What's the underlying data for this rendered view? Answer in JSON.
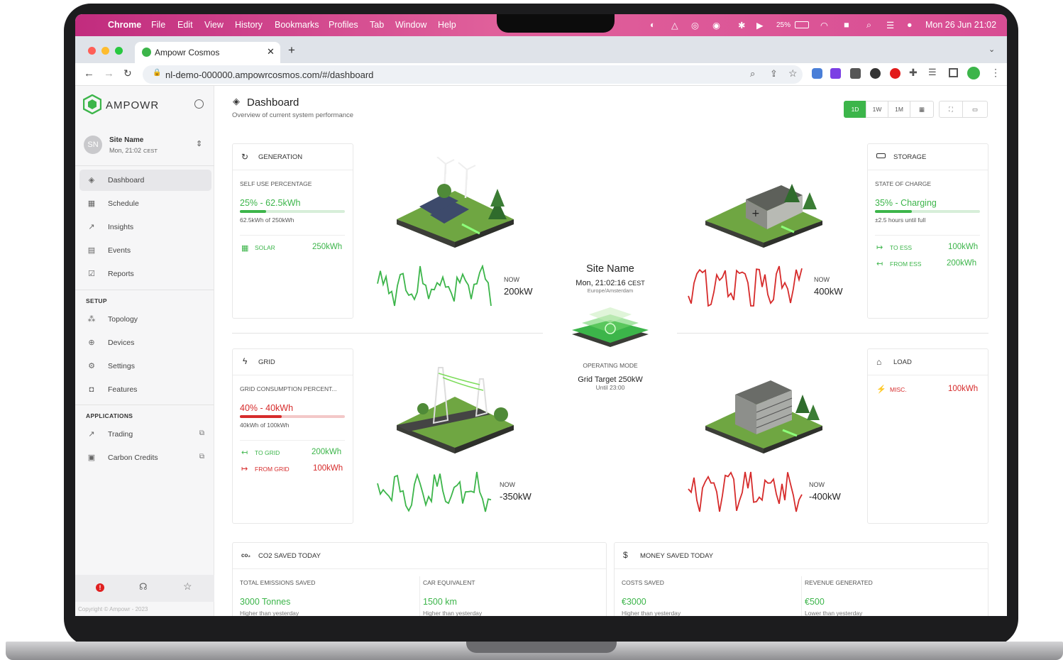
{
  "macos": {
    "app_name": "Chrome",
    "menus": [
      "File",
      "Edit",
      "View",
      "History",
      "Bookmarks",
      "Profiles",
      "Tab",
      "Window",
      "Help"
    ],
    "battery": "25%",
    "datetime": "Mon 26 Jun  21:02"
  },
  "browser": {
    "tab_title": "Ampowr Cosmos",
    "url": "nl-demo-000000.ampowrcosmos.com/#/dashboard"
  },
  "sidebar": {
    "logo_text": "AMPOWR",
    "site": {
      "initials": "SN",
      "name": "Site Name",
      "time": "Mon, 21:02",
      "tz": "CEST"
    },
    "main_items": [
      {
        "label": "Dashboard",
        "icon": "layers-icon"
      },
      {
        "label": "Schedule",
        "icon": "calendar-icon"
      },
      {
        "label": "Insights",
        "icon": "trend-icon"
      },
      {
        "label": "Events",
        "icon": "list-icon"
      },
      {
        "label": "Reports",
        "icon": "checkbox-icon"
      }
    ],
    "setup_title": "SETUP",
    "setup_items": [
      {
        "label": "Topology",
        "icon": "topology-icon"
      },
      {
        "label": "Devices",
        "icon": "device-icon"
      },
      {
        "label": "Settings",
        "icon": "gear-icon"
      },
      {
        "label": "Features",
        "icon": "bag-icon"
      }
    ],
    "apps_title": "APPLICATIONS",
    "app_items": [
      {
        "label": "Trading",
        "icon": "trading-icon"
      },
      {
        "label": "Carbon Credits",
        "icon": "document-icon"
      }
    ],
    "copyright": "Copyright © Ampowr - 2023"
  },
  "header": {
    "title": "Dashboard",
    "subtitle": "Overview of current system performance",
    "ranges": [
      "1D",
      "1W",
      "1M"
    ]
  },
  "generation": {
    "title": "GENERATION",
    "metric_label": "SELF USE PERCENTAGE",
    "metric_value": "25% - 62.5kWh",
    "progress": 0.25,
    "sub": "62.5kWh of 250kWh",
    "rows": [
      {
        "label": "SOLAR",
        "value": "250kWh"
      }
    ],
    "now_label": "NOW",
    "now_value": "200kW"
  },
  "storage": {
    "title": "STORAGE",
    "metric_label": "STATE OF CHARGE",
    "metric_value": "35% - Charging",
    "progress": 0.35,
    "sub": "±2.5 hours until full",
    "rows": [
      {
        "label": "TO ESS",
        "value": "100kWh"
      },
      {
        "label": "FROM ESS",
        "value": "200kWh"
      }
    ],
    "now_label": "NOW",
    "now_value": "400kW"
  },
  "grid": {
    "title": "GRID",
    "metric_label": "GRID CONSUMPTION PERCENT...",
    "metric_value": "40% - 40kWh",
    "progress": 0.4,
    "sub": "40kWh of 100kWh",
    "rows": [
      {
        "label": "TO GRID",
        "value": "200kWh"
      },
      {
        "label": "FROM GRID",
        "value": "100kWh"
      }
    ],
    "now_label": "NOW",
    "now_value": "-350kW"
  },
  "load": {
    "title": "LOAD",
    "rows": [
      {
        "label": "MISC.",
        "value": "100kWh"
      }
    ],
    "now_label": "NOW",
    "now_value": "-400kW"
  },
  "center": {
    "site_name": "Site Name",
    "time": "Mon, 21:02:16",
    "tz": "CEST",
    "zone": "Europe/Amsterdam",
    "mode_label": "OPERATING MODE",
    "mode_value": "Grid Target 250kW",
    "mode_until": "Until 23:00"
  },
  "co2": {
    "title": "CO2 SAVED TODAY",
    "left_label": "TOTAL EMISSIONS SAVED",
    "left_value": "3000 Tonnes",
    "left_note": "Higher than yesterday",
    "right_label": "CAR EQUIVALENT",
    "right_value": "1500 km",
    "right_note": "Higher than yesterday"
  },
  "money": {
    "title": "MONEY SAVED TODAY",
    "left_label": "COSTS SAVED",
    "left_value": "€3000",
    "left_note": "Higher than yesterday",
    "right_label": "REVENUE GENERATED",
    "right_value": "€500",
    "right_note": "Lower than yesterday"
  },
  "colors": {
    "accent": "#3cb54a",
    "danger": "#d62b2b",
    "menubar": "#d2458e"
  }
}
